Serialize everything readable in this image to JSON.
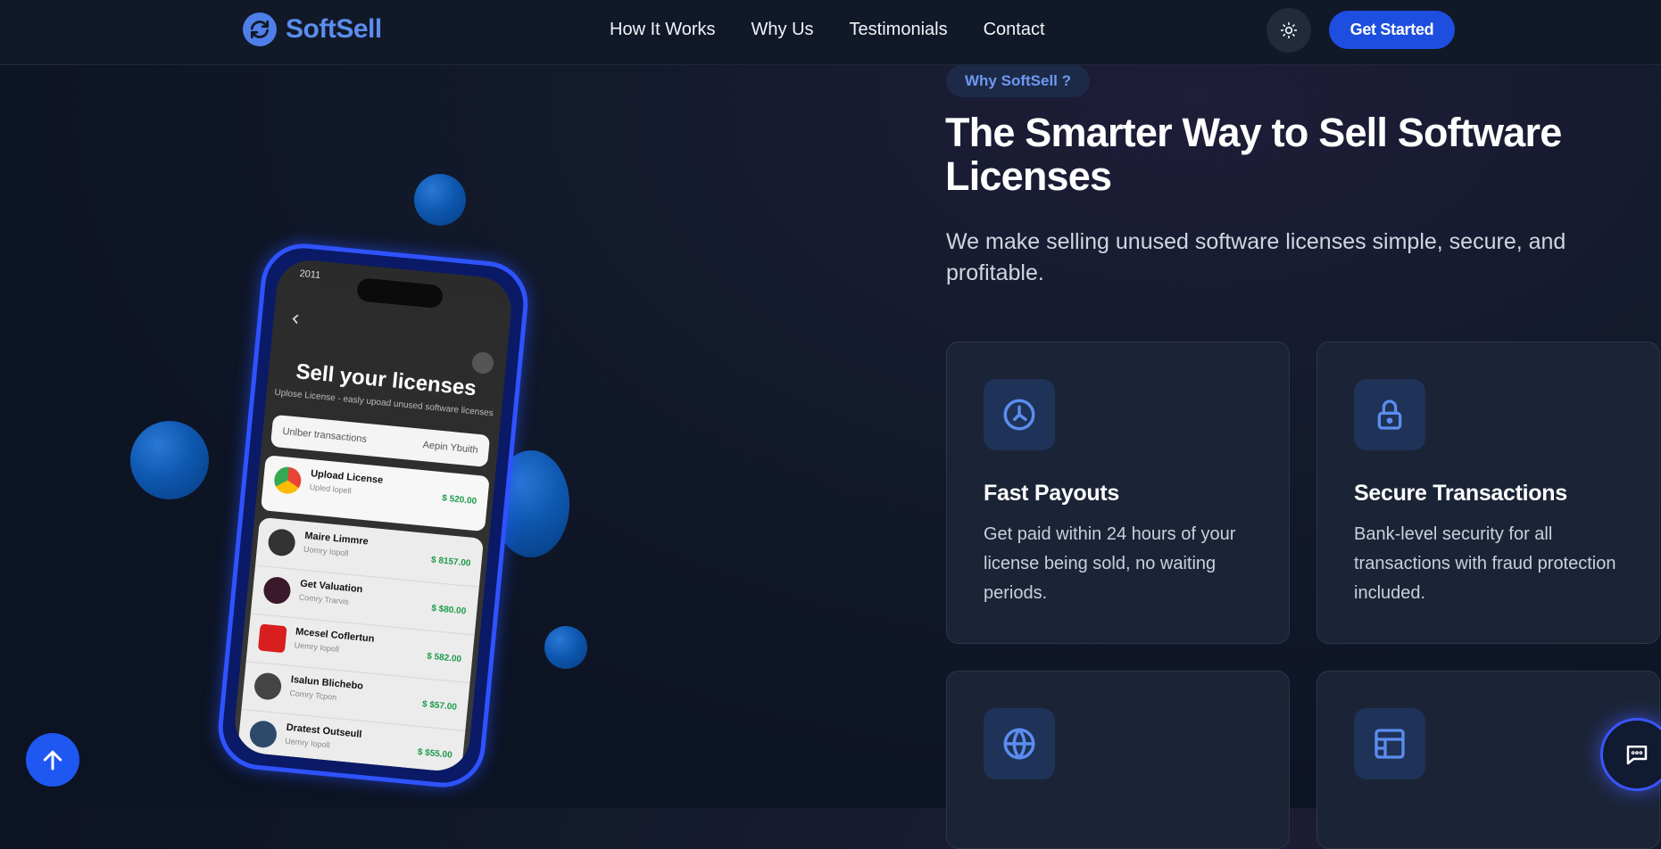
{
  "brand": {
    "name": "SoftSell",
    "accent": "#5b8def"
  },
  "nav": {
    "links": [
      "How It Works",
      "Why Us",
      "Testimonials",
      "Contact"
    ],
    "theme_icon": "sun-icon",
    "cta_label": "Get Started"
  },
  "why": {
    "badge": "Why SoftSell ?",
    "title": "The Smarter Way to Sell Software Licenses",
    "subtitle": "We make selling unused software licenses simple, secure, and profitable."
  },
  "features": [
    {
      "icon": "clock-icon",
      "title": "Fast Payouts",
      "text": "Get paid within 24 hours of your license being sold, no waiting periods."
    },
    {
      "icon": "lock-icon",
      "title": "Secure Transactions",
      "text": "Bank-level security for all transactions with fraud protection included."
    },
    {
      "icon": "globe-icon",
      "title": "",
      "text": ""
    },
    {
      "icon": "table-icon",
      "title": "",
      "text": ""
    }
  ],
  "phone": {
    "time": "2011",
    "title": "Sell your licenses",
    "subtitle": "Uplose License - easly upoad unused software licenses",
    "search_placeholder": "Unlber transactions",
    "search_filter": "Aepin Ybuith",
    "upload": {
      "name": "Upload License",
      "sub": "Upled lopell",
      "price": "$ 520.00"
    },
    "rows": [
      {
        "name": "Maire Limmre",
        "sub": "Uomry Iopoll",
        "price": "$ 8157.00"
      },
      {
        "name": "Get Valuation",
        "sub": "Comry Trarvis",
        "price": "$ $80.00"
      },
      {
        "name": "Mcesel Coflertun",
        "sub": "Uemry Iopoll",
        "price": "$ 582.00"
      },
      {
        "name": "Isalun Blichebo",
        "sub": "Comry Tcpon",
        "price": "$ $57.00"
      },
      {
        "name": "Dratest Outseull",
        "sub": "Uemry Iopoll",
        "price": "$ $55.00"
      }
    ]
  },
  "floating": {
    "scroll_top_icon": "arrow-up-icon",
    "chat_icon": "chat-icon"
  }
}
